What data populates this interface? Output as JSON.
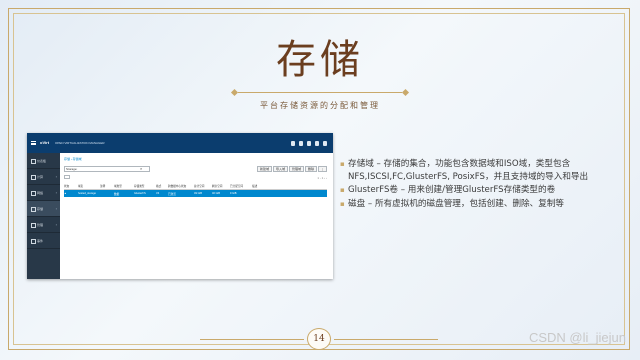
{
  "slide": {
    "title": "存储",
    "subtitle": "平台存储资源的分配和管理",
    "page_number": "14",
    "watermark": "CSDN @li_jiejun",
    "bullets": [
      "存储域 – 存储的集合，功能包含数据域和ISO域，类型包含NFS,ISCSI,FC,GlusterFS, PosixFS，并且支持域的导入和导出",
      "GlusterFS卷 – 用来创建/管理GlusterFS存储类型的卷",
      "磁盘 – 所有虚拟机的磁盘管理，包括创建、删除、复制等"
    ],
    "colors": {
      "accent": "#c9a96b",
      "title": "#6b3e1f",
      "app_header": "#0b3d6e",
      "app_sidebar": "#283848",
      "app_selected": "#0088ce"
    }
  },
  "app": {
    "brand": "oVirt",
    "brand_sub": "OPEN VIRTUALIZATION MANAGER",
    "top_icons": [
      "flag-icon",
      "bell-icon",
      "help-icon",
      "user-icon",
      "gear-icon"
    ],
    "sidebar": [
      {
        "label": "仪表板",
        "icon": "dashboard-icon",
        "active": false
      },
      {
        "label": "计算",
        "icon": "compute-icon",
        "active": false
      },
      {
        "label": "网络",
        "icon": "network-icon",
        "active": false
      },
      {
        "label": "存储",
        "icon": "storage-icon",
        "active": true
      },
      {
        "label": "管理",
        "icon": "admin-icon",
        "active": false
      },
      {
        "label": "事件",
        "icon": "events-icon",
        "active": false
      }
    ],
    "breadcrumb": "存储 › 存储域",
    "search": {
      "value": "Storage:",
      "placeholder": ""
    },
    "buttons": [
      "新建域",
      "导入域",
      "管理域",
      "删除",
      "⋮"
    ],
    "pager": "1 - 1 ‹ ›",
    "table": {
      "headers": [
        "状态",
        "域名",
        "注释",
        "域类型",
        "存储类型",
        "格式",
        "跨数据中心状态",
        "总计空间",
        "剩余空间",
        "已分配空间",
        "描述"
      ],
      "rows": [
        [
          "▲",
          "hosted_storage",
          "",
          "数据",
          "GlusterFS",
          "V4",
          "已激活",
          "49 GiB",
          "40 GiB",
          "9 GiB",
          ""
        ]
      ]
    }
  }
}
